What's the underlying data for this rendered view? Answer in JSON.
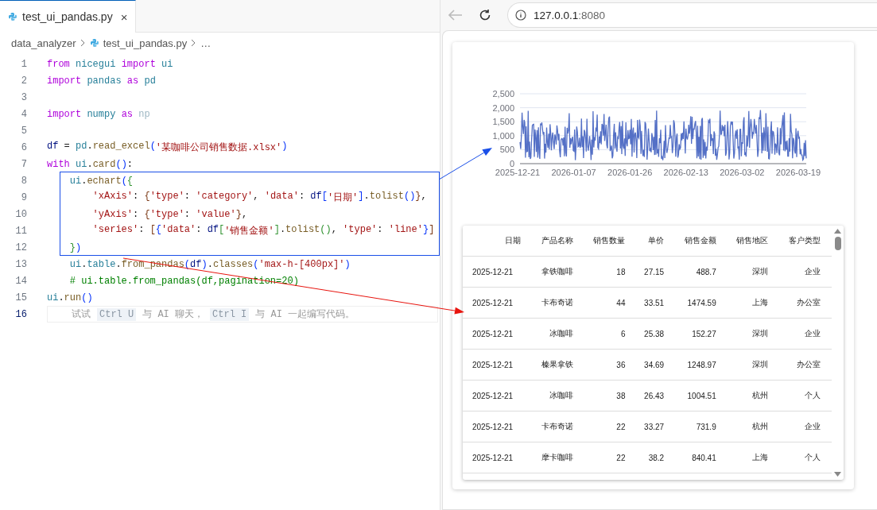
{
  "editor": {
    "tab": {
      "label": "test_ui_pandas.py",
      "close": "×",
      "selected": true
    },
    "breadcrumb": [
      "data_analyzer",
      "test_ui_pandas.py",
      "…"
    ],
    "lines": [
      {
        "number": "1",
        "tokens": [
          {
            "kind": "kw",
            "text": "from"
          },
          {
            "kind": "mod",
            "text": " nicegui "
          },
          {
            "kind": "kw",
            "text": "import"
          },
          {
            "kind": "mod",
            "text": " ui"
          }
        ]
      },
      {
        "number": "2",
        "tokens": [
          {
            "kind": "kw",
            "text": "import"
          },
          {
            "kind": "mod",
            "text": " pandas "
          },
          {
            "kind": "kw",
            "text": "as"
          },
          {
            "kind": "mod",
            "text": " pd"
          }
        ]
      },
      {
        "number": "3"
      },
      {
        "number": "4",
        "tokens": [
          {
            "kind": "kw",
            "text": "import"
          },
          {
            "kind": "mod",
            "text": " numpy "
          },
          {
            "kind": "kw",
            "text": "as"
          },
          {
            "kind": "dim",
            "text": " np"
          }
        ]
      },
      {
        "number": "5"
      },
      {
        "number": "6",
        "tokens": [
          {
            "kind": "var",
            "text": "df"
          },
          {
            "kind": "op",
            "text": " = "
          },
          {
            "kind": "mod",
            "text": "pd"
          },
          {
            "kind": "op",
            "text": "."
          },
          {
            "kind": "fn",
            "text": "read_excel"
          },
          {
            "kind": "br1",
            "text": "("
          },
          {
            "kind": "str",
            "text": "'某咖啡公司销售数据.xlsx'"
          },
          {
            "kind": "br1",
            "text": ")"
          }
        ]
      },
      {
        "number": "7",
        "tokens": [
          {
            "kind": "kw",
            "text": "with"
          },
          {
            "kind": "mod",
            "text": " ui"
          },
          {
            "kind": "op",
            "text": "."
          },
          {
            "kind": "fn",
            "text": "card"
          },
          {
            "kind": "br1",
            "text": "()"
          },
          {
            "kind": "op",
            "text": ":"
          }
        ]
      },
      {
        "number": "8",
        "tokens": [
          {
            "kind": "mod",
            "text": "    ui"
          },
          {
            "kind": "op",
            "text": "."
          },
          {
            "kind": "fn",
            "text": "echart"
          },
          {
            "kind": "br1",
            "text": "("
          },
          {
            "kind": "br2",
            "text": "{"
          }
        ]
      },
      {
        "number": "9",
        "tokens": [
          {
            "kind": "str",
            "text": "        'xAxis'"
          },
          {
            "kind": "op",
            "text": ": "
          },
          {
            "kind": "br3",
            "text": "{"
          },
          {
            "kind": "str",
            "text": "'type'"
          },
          {
            "kind": "op",
            "text": ": "
          },
          {
            "kind": "str",
            "text": "'category'"
          },
          {
            "kind": "op",
            "text": ", "
          },
          {
            "kind": "str",
            "text": "'data'"
          },
          {
            "kind": "op",
            "text": ": "
          },
          {
            "kind": "var",
            "text": "df"
          },
          {
            "kind": "br1",
            "text": "["
          },
          {
            "kind": "str",
            "text": "'日期'"
          },
          {
            "kind": "br1",
            "text": "]"
          },
          {
            "kind": "op",
            "text": "."
          },
          {
            "kind": "fn",
            "text": "tolist"
          },
          {
            "kind": "br1",
            "text": "()"
          },
          {
            "kind": "br3",
            "text": "}"
          },
          {
            "kind": "op",
            "text": ","
          }
        ]
      },
      {
        "number": "10",
        "tokens": [
          {
            "kind": "str",
            "text": "        'yAxis'"
          },
          {
            "kind": "op",
            "text": ": "
          },
          {
            "kind": "br3",
            "text": "{"
          },
          {
            "kind": "str",
            "text": "'type'"
          },
          {
            "kind": "op",
            "text": ": "
          },
          {
            "kind": "str",
            "text": "'value'"
          },
          {
            "kind": "br3",
            "text": "}"
          },
          {
            "kind": "op",
            "text": ","
          }
        ]
      },
      {
        "number": "11",
        "tokens": [
          {
            "kind": "str",
            "text": "        'series'"
          },
          {
            "kind": "op",
            "text": ": "
          },
          {
            "kind": "br3",
            "text": "["
          },
          {
            "kind": "br1",
            "text": "{"
          },
          {
            "kind": "str",
            "text": "'data'"
          },
          {
            "kind": "op",
            "text": ": "
          },
          {
            "kind": "var",
            "text": "df"
          },
          {
            "kind": "br2",
            "text": "["
          },
          {
            "kind": "str",
            "text": "'销售金额'"
          },
          {
            "kind": "br2",
            "text": "]"
          },
          {
            "kind": "op",
            "text": "."
          },
          {
            "kind": "fn",
            "text": "tolist"
          },
          {
            "kind": "br2",
            "text": "()"
          },
          {
            "kind": "op",
            "text": ", "
          },
          {
            "kind": "str",
            "text": "'type'"
          },
          {
            "kind": "op",
            "text": ": "
          },
          {
            "kind": "str",
            "text": "'line'"
          },
          {
            "kind": "br1",
            "text": "}"
          },
          {
            "kind": "br3",
            "text": "]"
          }
        ]
      },
      {
        "number": "12",
        "tokens": [
          {
            "kind": "br2",
            "text": "    }"
          },
          {
            "kind": "br1",
            "text": ")"
          }
        ]
      },
      {
        "number": "13",
        "tokens": [
          {
            "kind": "mod",
            "text": "    ui"
          },
          {
            "kind": "op",
            "text": "."
          },
          {
            "kind": "mod",
            "text": "table"
          },
          {
            "kind": "op",
            "text": "."
          },
          {
            "kind": "fn",
            "text": "from_pandas"
          },
          {
            "kind": "br1",
            "text": "("
          },
          {
            "kind": "var",
            "text": "df"
          },
          {
            "kind": "br1",
            "text": ")"
          },
          {
            "kind": "op",
            "text": "."
          },
          {
            "kind": "fn",
            "text": "classes"
          },
          {
            "kind": "br1",
            "text": "("
          },
          {
            "kind": "str",
            "text": "'max-h-[400px]'"
          },
          {
            "kind": "br1",
            "text": ")"
          }
        ]
      },
      {
        "number": "14",
        "tokens": [
          {
            "kind": "cmt",
            "text": "    # ui.table.from_pandas(df,pagination=20)"
          }
        ]
      },
      {
        "number": "15",
        "tokens": [
          {
            "kind": "mod",
            "text": "ui"
          },
          {
            "kind": "op",
            "text": "."
          },
          {
            "kind": "fn",
            "text": "run"
          },
          {
            "kind": "br1",
            "text": "()"
          }
        ]
      },
      {
        "number": "16",
        "hint": [
          {
            "kind": "text",
            "text": "试试"
          },
          {
            "kind": "key",
            "text": "Ctrl U"
          },
          {
            "kind": "text",
            "text": "与 AI 聊天，"
          },
          {
            "kind": "key",
            "text": "Ctrl I"
          },
          {
            "kind": "text",
            "text": "与 AI 一起编写代码。"
          }
        ]
      }
    ]
  },
  "browser": {
    "address": {
      "host": "127.0.0.1",
      "port": ":8080"
    },
    "chart": {
      "yticks": [
        "2,500",
        "2,000",
        "1,500",
        "1,000",
        "500",
        "0"
      ],
      "xlabels": [
        "2025-12-21",
        "2026-01-07",
        "2026-01-26",
        "2026-02-13",
        "2026-03-02",
        "2026-03-19"
      ]
    },
    "table": {
      "columns": [
        "日期",
        "产品名称",
        "销售数量",
        "单价",
        "销售金额",
        "销售地区",
        "客户类型"
      ],
      "rows": [
        [
          "2025-12-21",
          "拿铁咖啡",
          "18",
          "27.15",
          "488.7",
          "深圳",
          "企业"
        ],
        [
          "2025-12-21",
          "卡布奇诺",
          "44",
          "33.51",
          "1474.59",
          "上海",
          "办公室"
        ],
        [
          "2025-12-21",
          "冰咖啡",
          "6",
          "25.38",
          "152.27",
          "深圳",
          "企业"
        ],
        [
          "2025-12-21",
          "榛果拿铁",
          "36",
          "34.69",
          "1248.97",
          "深圳",
          "办公室"
        ],
        [
          "2025-12-21",
          "冰咖啡",
          "38",
          "26.43",
          "1004.51",
          "杭州",
          "个人"
        ],
        [
          "2025-12-21",
          "卡布奇诺",
          "22",
          "33.27",
          "731.9",
          "杭州",
          "企业"
        ],
        [
          "2025-12-21",
          "摩卡咖啡",
          "22",
          "38.2",
          "840.41",
          "上海",
          "个人"
        ]
      ]
    }
  },
  "annotations": [
    {
      "kind": "box",
      "color": "#1a4fe8"
    },
    {
      "kind": "arrow",
      "color": "#1a4fe8"
    },
    {
      "kind": "arrow",
      "color": "#e8140e"
    }
  ]
}
